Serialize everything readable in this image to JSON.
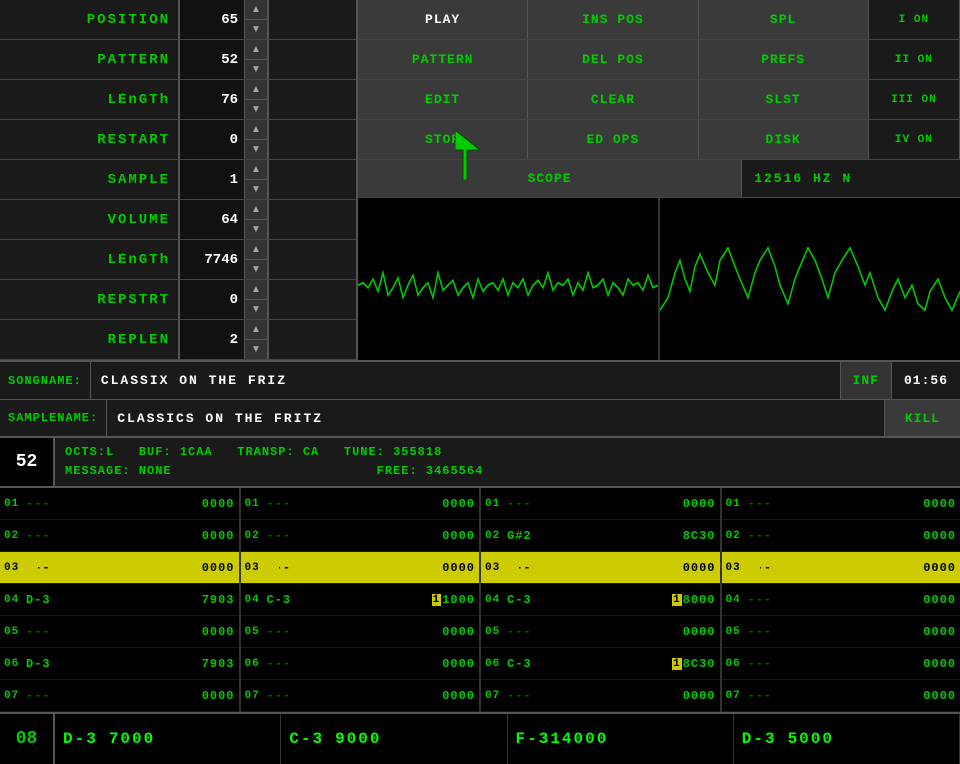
{
  "controls": {
    "position": {
      "label": "POSITION",
      "value": "65"
    },
    "pattern": {
      "label": "PATTERN",
      "value": "52"
    },
    "length": {
      "label": "LEnGTh",
      "value": "76"
    },
    "restart": {
      "label": "RESTART",
      "value": "0"
    },
    "sample": {
      "label": "SAMPLE",
      "value": "1"
    },
    "volume": {
      "label": "VOLUME",
      "value": "64"
    },
    "slength": {
      "label": "LEnGTh",
      "value": "7746"
    },
    "repstrt": {
      "label": "REPSTRT",
      "value": "0"
    },
    "replen": {
      "label": "REPLEN",
      "value": "2"
    }
  },
  "buttons": {
    "play": "PLAY",
    "ins_pos": "INS POS",
    "spl": "SPL",
    "on1": "I ON",
    "pattern": "PATTERN",
    "del_pos": "DEL POS",
    "prefs": "PREFS",
    "on2": "II ON",
    "edit": "EDIT",
    "clear": "CLEAR",
    "slst": "SLST",
    "on3": "III ON",
    "stop": "STOP",
    "ed_ops": "ED OPS",
    "disk": "DISK",
    "on4": "IV ON",
    "scope": "SCOPE",
    "kill": "KILL"
  },
  "scope": {
    "label": "SCOPE",
    "freq": "12516 HZ N"
  },
  "song": {
    "name_label": "SONGNAME:",
    "name": "CLASSIX ON THE FRIZ",
    "inf": "INF",
    "time": "01:56",
    "sample_label": "SAMPLENAME:",
    "sample_name": "CLASSICS ON THE FRITZ"
  },
  "pattern": {
    "number": "52",
    "octs": "OCTS:L",
    "buf": "BUF: 1CAA",
    "transp": "TRANSP: CA",
    "tune": "TUNE:  355818",
    "message": "MESSAGE: NONE",
    "free": "FREE: 3465564"
  },
  "tracks": [
    {
      "rows": [
        {
          "num": "01",
          "note": "---",
          "vol": "0000"
        },
        {
          "num": "02",
          "note": "---",
          "vol": "0000",
          "highlight": false
        },
        {
          "num": "03",
          "note": "---",
          "vol": "0000",
          "highlight": true
        },
        {
          "num": "04",
          "note": "D-3",
          "vol": "7903"
        },
        {
          "num": "05",
          "note": "---",
          "vol": "0000"
        },
        {
          "num": "06",
          "note": "D-3",
          "vol": "7903"
        },
        {
          "num": "07",
          "note": "---",
          "vol": "0000"
        }
      ]
    },
    {
      "rows": [
        {
          "num": "01",
          "note": "---",
          "vol": "0000"
        },
        {
          "num": "02",
          "note": "---",
          "vol": "0000"
        },
        {
          "num": "03",
          "note": "---",
          "vol": "0000",
          "highlight": true
        },
        {
          "num": "04",
          "note": "C-3",
          "vol": "1000",
          "extra": "1"
        },
        {
          "num": "05",
          "note": "---",
          "vol": "0000"
        },
        {
          "num": "06",
          "note": "---",
          "vol": "0000"
        },
        {
          "num": "07",
          "note": "---",
          "vol": "0000"
        }
      ]
    },
    {
      "rows": [
        {
          "num": "01",
          "note": "---",
          "vol": "0000"
        },
        {
          "num": "02",
          "note": "G#2",
          "vol": "8C30"
        },
        {
          "num": "03",
          "note": "---",
          "vol": "0000",
          "highlight": true
        },
        {
          "num": "04",
          "note": "C-3",
          "vol": "18000",
          "extra": "1"
        },
        {
          "num": "05",
          "note": "---",
          "vol": "0000"
        },
        {
          "num": "06",
          "note": "C-3",
          "vol": "18C30",
          "extra": "1"
        },
        {
          "num": "07",
          "note": "---",
          "vol": "0000"
        }
      ]
    },
    {
      "rows": [
        {
          "num": "01",
          "note": "---",
          "vol": "0000"
        },
        {
          "num": "02",
          "note": "---",
          "vol": "0000"
        },
        {
          "num": "03",
          "note": "---",
          "vol": "0000",
          "highlight": true
        },
        {
          "num": "04",
          "note": "---",
          "vol": "0000"
        },
        {
          "num": "05",
          "note": "---",
          "vol": "0000"
        },
        {
          "num": "06",
          "note": "---",
          "vol": "0000"
        },
        {
          "num": "07",
          "note": "---",
          "vol": "0000"
        }
      ]
    }
  ],
  "bottom": {
    "row": "08",
    "cells": [
      {
        "note": "D-3",
        "val": "7000"
      },
      {
        "note": "C-3",
        "val": "9000"
      },
      {
        "note": "F-3",
        "val": "14000"
      },
      {
        "note": "D-3",
        "val": "5000"
      }
    ]
  }
}
